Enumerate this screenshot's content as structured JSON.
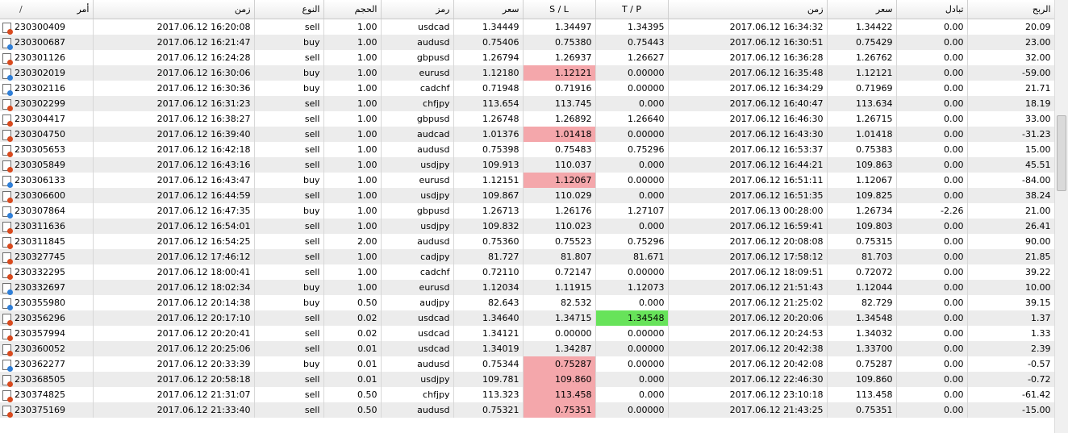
{
  "headers": {
    "order": "أمر",
    "open_time": "زمن",
    "type": "النوع",
    "size": "الحجم",
    "symbol": "رمز",
    "open_price": "سعر",
    "sl": "S / L",
    "tp": "T / P",
    "close_time": "زمن",
    "close_price": "سعر",
    "swap": "تبادل",
    "profit": "الربح",
    "sort_indicator": "/"
  },
  "colors": {
    "sell_icon_dot": "#d94a1e",
    "buy_icon_dot": "#2f7fd8",
    "sl_hit": "#f4a7ab",
    "tp_hit": "#67e35a"
  },
  "rows": [
    {
      "order": "230300409",
      "open_time": "2017.06.12 16:20:08",
      "type": "sell",
      "size": "1.00",
      "symbol": "usdcad",
      "open_price": "1.34449",
      "sl": "1.34497",
      "tp": "1.34395",
      "close_time": "2017.06.12 16:34:32",
      "close_price": "1.34422",
      "swap": "0.00",
      "profit": "20.09",
      "hl": ""
    },
    {
      "order": "230300687",
      "open_time": "2017.06.12 16:21:47",
      "type": "buy",
      "size": "1.00",
      "symbol": "audusd",
      "open_price": "0.75406",
      "sl": "0.75380",
      "tp": "0.75443",
      "close_time": "2017.06.12 16:30:51",
      "close_price": "0.75429",
      "swap": "0.00",
      "profit": "23.00",
      "hl": ""
    },
    {
      "order": "230301126",
      "open_time": "2017.06.12 16:24:28",
      "type": "sell",
      "size": "1.00",
      "symbol": "gbpusd",
      "open_price": "1.26794",
      "sl": "1.26937",
      "tp": "1.26627",
      "close_time": "2017.06.12 16:36:28",
      "close_price": "1.26762",
      "swap": "0.00",
      "profit": "32.00",
      "hl": ""
    },
    {
      "order": "230302019",
      "open_time": "2017.06.12 16:30:06",
      "type": "buy",
      "size": "1.00",
      "symbol": "eurusd",
      "open_price": "1.12180",
      "sl": "1.12121",
      "tp": "0.00000",
      "close_time": "2017.06.12 16:35:48",
      "close_price": "1.12121",
      "swap": "0.00",
      "profit": "-59.00",
      "hl": "sl"
    },
    {
      "order": "230302116",
      "open_time": "2017.06.12 16:30:36",
      "type": "buy",
      "size": "1.00",
      "symbol": "cadchf",
      "open_price": "0.71948",
      "sl": "0.71916",
      "tp": "0.00000",
      "close_time": "2017.06.12 16:34:29",
      "close_price": "0.71969",
      "swap": "0.00",
      "profit": "21.71",
      "hl": ""
    },
    {
      "order": "230302299",
      "open_time": "2017.06.12 16:31:23",
      "type": "sell",
      "size": "1.00",
      "symbol": "chfjpy",
      "open_price": "113.654",
      "sl": "113.745",
      "tp": "0.000",
      "close_time": "2017.06.12 16:40:47",
      "close_price": "113.634",
      "swap": "0.00",
      "profit": "18.19",
      "hl": ""
    },
    {
      "order": "230304417",
      "open_time": "2017.06.12 16:38:27",
      "type": "sell",
      "size": "1.00",
      "symbol": "gbpusd",
      "open_price": "1.26748",
      "sl": "1.26892",
      "tp": "1.26640",
      "close_time": "2017.06.12 16:46:30",
      "close_price": "1.26715",
      "swap": "0.00",
      "profit": "33.00",
      "hl": ""
    },
    {
      "order": "230304750",
      "open_time": "2017.06.12 16:39:40",
      "type": "sell",
      "size": "1.00",
      "symbol": "audcad",
      "open_price": "1.01376",
      "sl": "1.01418",
      "tp": "0.00000",
      "close_time": "2017.06.12 16:43:30",
      "close_price": "1.01418",
      "swap": "0.00",
      "profit": "-31.23",
      "hl": "sl"
    },
    {
      "order": "230305653",
      "open_time": "2017.06.12 16:42:18",
      "type": "sell",
      "size": "1.00",
      "symbol": "audusd",
      "open_price": "0.75398",
      "sl": "0.75483",
      "tp": "0.75296",
      "close_time": "2017.06.12 16:53:37",
      "close_price": "0.75383",
      "swap": "0.00",
      "profit": "15.00",
      "hl": ""
    },
    {
      "order": "230305849",
      "open_time": "2017.06.12 16:43:16",
      "type": "sell",
      "size": "1.00",
      "symbol": "usdjpy",
      "open_price": "109.913",
      "sl": "110.037",
      "tp": "0.000",
      "close_time": "2017.06.12 16:44:21",
      "close_price": "109.863",
      "swap": "0.00",
      "profit": "45.51",
      "hl": ""
    },
    {
      "order": "230306133",
      "open_time": "2017.06.12 16:43:47",
      "type": "buy",
      "size": "1.00",
      "symbol": "eurusd",
      "open_price": "1.12151",
      "sl": "1.12067",
      "tp": "0.00000",
      "close_time": "2017.06.12 16:51:11",
      "close_price": "1.12067",
      "swap": "0.00",
      "profit": "-84.00",
      "hl": "sl"
    },
    {
      "order": "230306600",
      "open_time": "2017.06.12 16:44:59",
      "type": "sell",
      "size": "1.00",
      "symbol": "usdjpy",
      "open_price": "109.867",
      "sl": "110.029",
      "tp": "0.000",
      "close_time": "2017.06.12 16:51:35",
      "close_price": "109.825",
      "swap": "0.00",
      "profit": "38.24",
      "hl": ""
    },
    {
      "order": "230307864",
      "open_time": "2017.06.12 16:47:35",
      "type": "buy",
      "size": "1.00",
      "symbol": "gbpusd",
      "open_price": "1.26713",
      "sl": "1.26176",
      "tp": "1.27107",
      "close_time": "2017.06.13 00:28:00",
      "close_price": "1.26734",
      "swap": "-2.26",
      "profit": "21.00",
      "hl": ""
    },
    {
      "order": "230311636",
      "open_time": "2017.06.12 16:54:01",
      "type": "sell",
      "size": "1.00",
      "symbol": "usdjpy",
      "open_price": "109.832",
      "sl": "110.023",
      "tp": "0.000",
      "close_time": "2017.06.12 16:59:41",
      "close_price": "109.803",
      "swap": "0.00",
      "profit": "26.41",
      "hl": ""
    },
    {
      "order": "230311845",
      "open_time": "2017.06.12 16:54:25",
      "type": "sell",
      "size": "2.00",
      "symbol": "audusd",
      "open_price": "0.75360",
      "sl": "0.75523",
      "tp": "0.75296",
      "close_time": "2017.06.12 20:08:08",
      "close_price": "0.75315",
      "swap": "0.00",
      "profit": "90.00",
      "hl": ""
    },
    {
      "order": "230327745",
      "open_time": "2017.06.12 17:46:12",
      "type": "sell",
      "size": "1.00",
      "symbol": "cadjpy",
      "open_price": "81.727",
      "sl": "81.807",
      "tp": "81.671",
      "close_time": "2017.06.12 17:58:12",
      "close_price": "81.703",
      "swap": "0.00",
      "profit": "21.85",
      "hl": ""
    },
    {
      "order": "230332295",
      "open_time": "2017.06.12 18:00:41",
      "type": "sell",
      "size": "1.00",
      "symbol": "cadchf",
      "open_price": "0.72110",
      "sl": "0.72147",
      "tp": "0.00000",
      "close_time": "2017.06.12 18:09:51",
      "close_price": "0.72072",
      "swap": "0.00",
      "profit": "39.22",
      "hl": ""
    },
    {
      "order": "230332697",
      "open_time": "2017.06.12 18:02:34",
      "type": "buy",
      "size": "1.00",
      "symbol": "eurusd",
      "open_price": "1.12034",
      "sl": "1.11915",
      "tp": "1.12073",
      "close_time": "2017.06.12 21:51:43",
      "close_price": "1.12044",
      "swap": "0.00",
      "profit": "10.00",
      "hl": ""
    },
    {
      "order": "230355980",
      "open_time": "2017.06.12 20:14:38",
      "type": "buy",
      "size": "0.50",
      "symbol": "audjpy",
      "open_price": "82.643",
      "sl": "82.532",
      "tp": "0.000",
      "close_time": "2017.06.12 21:25:02",
      "close_price": "82.729",
      "swap": "0.00",
      "profit": "39.15",
      "hl": ""
    },
    {
      "order": "230356296",
      "open_time": "2017.06.12 20:17:10",
      "type": "sell",
      "size": "0.02",
      "symbol": "usdcad",
      "open_price": "1.34640",
      "sl": "1.34715",
      "tp": "1.34548",
      "close_time": "2017.06.12 20:20:06",
      "close_price": "1.34548",
      "swap": "0.00",
      "profit": "1.37",
      "hl": "tp"
    },
    {
      "order": "230357994",
      "open_time": "2017.06.12 20:20:41",
      "type": "sell",
      "size": "0.02",
      "symbol": "usdcad",
      "open_price": "1.34121",
      "sl": "0.00000",
      "tp": "0.00000",
      "close_time": "2017.06.12 20:24:53",
      "close_price": "1.34032",
      "swap": "0.00",
      "profit": "1.33",
      "hl": ""
    },
    {
      "order": "230360052",
      "open_time": "2017.06.12 20:25:06",
      "type": "sell",
      "size": "0.01",
      "symbol": "usdcad",
      "open_price": "1.34019",
      "sl": "1.34287",
      "tp": "0.00000",
      "close_time": "2017.06.12 20:42:38",
      "close_price": "1.33700",
      "swap": "0.00",
      "profit": "2.39",
      "hl": ""
    },
    {
      "order": "230362277",
      "open_time": "2017.06.12 20:33:39",
      "type": "buy",
      "size": "0.01",
      "symbol": "audusd",
      "open_price": "0.75344",
      "sl": "0.75287",
      "tp": "0.00000",
      "close_time": "2017.06.12 20:42:08",
      "close_price": "0.75287",
      "swap": "0.00",
      "profit": "-0.57",
      "hl": "sl"
    },
    {
      "order": "230368505",
      "open_time": "2017.06.12 20:58:18",
      "type": "sell",
      "size": "0.01",
      "symbol": "usdjpy",
      "open_price": "109.781",
      "sl": "109.860",
      "tp": "0.000",
      "close_time": "2017.06.12 22:46:30",
      "close_price": "109.860",
      "swap": "0.00",
      "profit": "-0.72",
      "hl": "sl"
    },
    {
      "order": "230374825",
      "open_time": "2017.06.12 21:31:07",
      "type": "sell",
      "size": "0.50",
      "symbol": "chfjpy",
      "open_price": "113.323",
      "sl": "113.458",
      "tp": "0.000",
      "close_time": "2017.06.12 23:10:18",
      "close_price": "113.458",
      "swap": "0.00",
      "profit": "-61.42",
      "hl": "sl"
    },
    {
      "order": "230375169",
      "open_time": "2017.06.12 21:33:40",
      "type": "sell",
      "size": "0.50",
      "symbol": "audusd",
      "open_price": "0.75321",
      "sl": "0.75351",
      "tp": "0.00000",
      "close_time": "2017.06.12 21:43:25",
      "close_price": "0.75351",
      "swap": "0.00",
      "profit": "-15.00",
      "hl": "sl"
    }
  ]
}
